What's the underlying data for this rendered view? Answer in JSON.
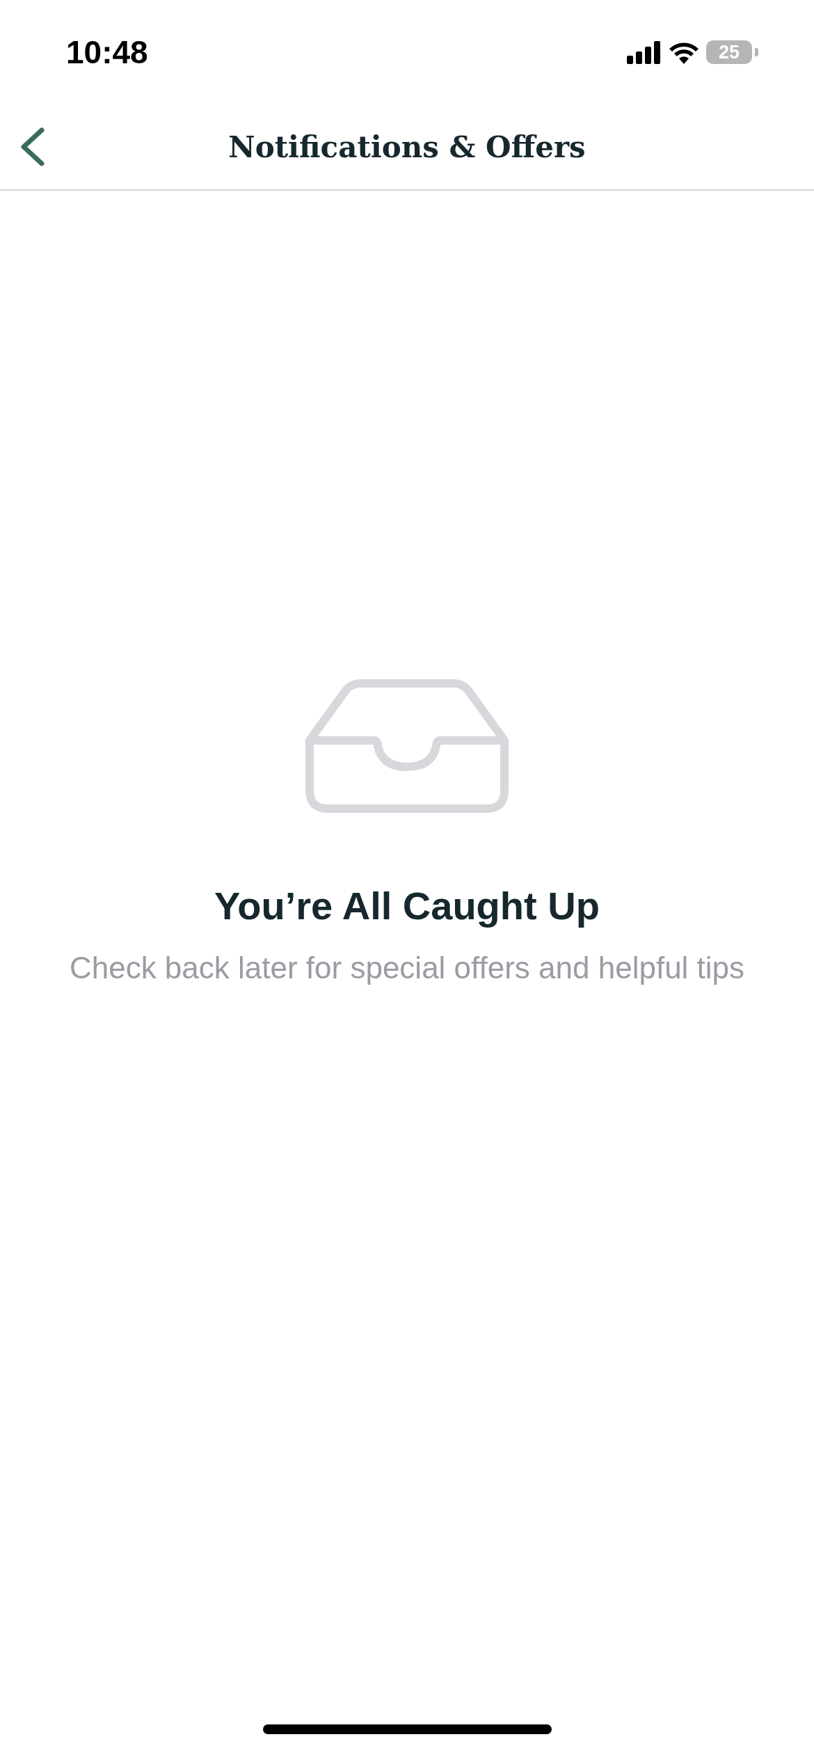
{
  "status_bar": {
    "time": "10:48",
    "battery": "25"
  },
  "header": {
    "title": "Notifications & Offers"
  },
  "empty_state": {
    "title": "You’re All Caught Up",
    "message": "Check back later for special offers and helpful tips"
  }
}
